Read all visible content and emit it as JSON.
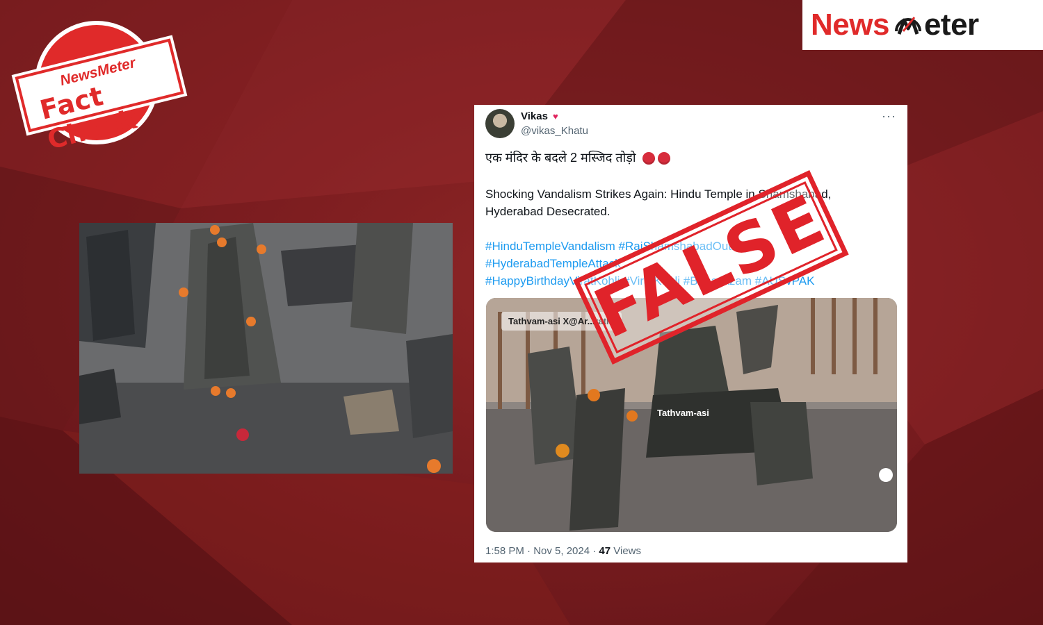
{
  "colors": {
    "background": "#7a1c1f",
    "brand_red": "#e02a2a",
    "link_blue": "#1d9bf0",
    "stamp_red": "#e0232a"
  },
  "fact_check_stamp": {
    "brand": "NewsMeter",
    "title": "Fact Check"
  },
  "logo": {
    "news": "News",
    "meter": "eter",
    "mark_icon": "speedometer-m-icon"
  },
  "tweet": {
    "author_name": "Vikas",
    "author_handle": "@vikas_Khatu",
    "hindi_text": "एक मंदिर के बदले 2 मस्जिद तोड़ो",
    "body_text": "Shocking Vandalism Strikes Again: Hindu Temple in Shamshabad, Hyderabad Desecrated.",
    "hashtags": [
      "#HinduTempleVandalism #RajShamshabadOutrage",
      "#HyderabadTempleAttack",
      "#HappyBirthdayViratKohli #ViratKohli #BabarAzam #AUSvPAK"
    ],
    "media_watermark_1": "Tathvam-asi X@Ar...rathi",
    "media_watermark_2": "Tathvam-asi",
    "timestamp": "1:58 PM · Nov 5, 2024 · ",
    "views_count": "47",
    "views_label": " Views"
  },
  "verdict_stamp": {
    "text": "FALSE"
  }
}
